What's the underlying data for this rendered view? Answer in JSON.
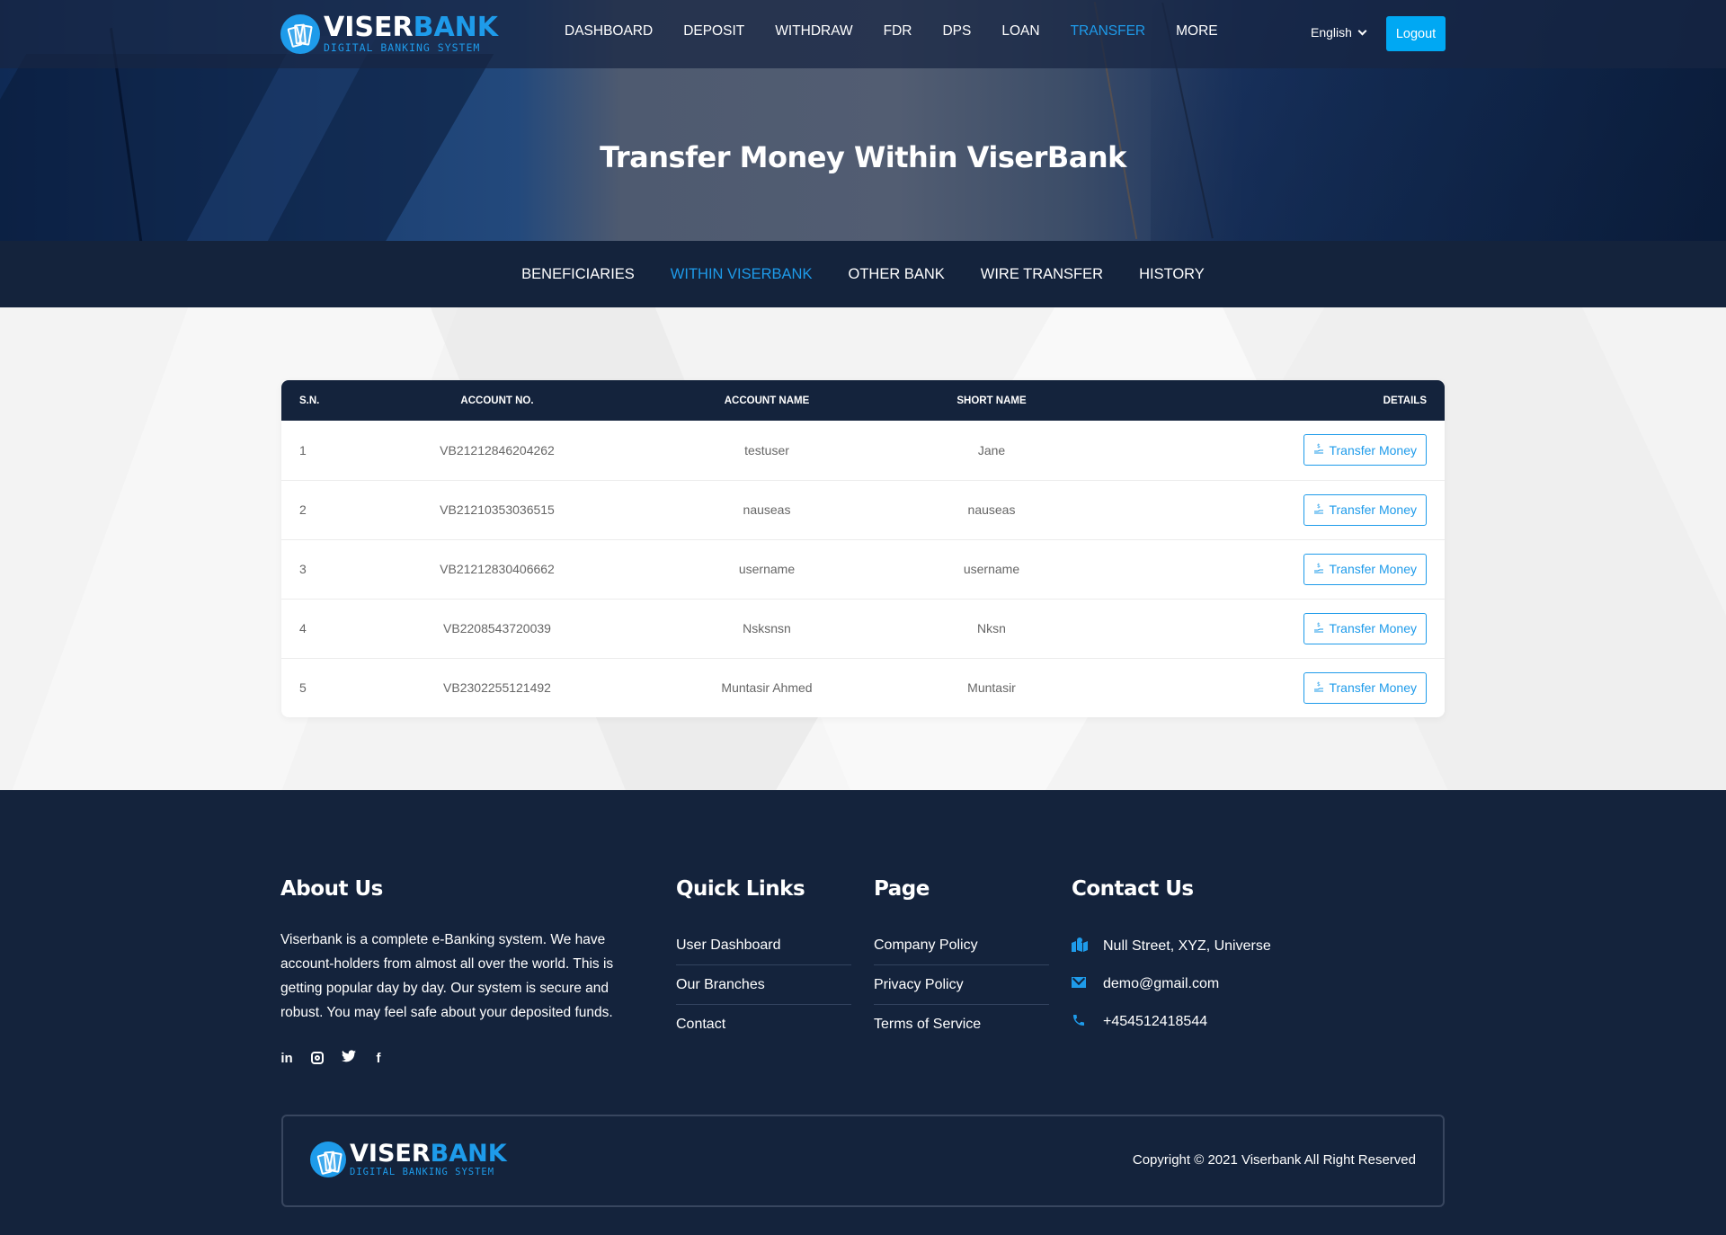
{
  "brand": {
    "name_white": "VISER",
    "name_blue": "BANK",
    "tagline": "DIGITAL BANKING SYSTEM",
    "accent_color": "#1e9bea",
    "dark_color": "#14233c"
  },
  "header": {
    "nav": [
      {
        "label": "DASHBOARD",
        "active": false
      },
      {
        "label": "DEPOSIT",
        "active": false
      },
      {
        "label": "WITHDRAW",
        "active": false
      },
      {
        "label": "FDR",
        "active": false
      },
      {
        "label": "DPS",
        "active": false
      },
      {
        "label": "LOAN",
        "active": false
      },
      {
        "label": "TRANSFER",
        "active": true
      },
      {
        "label": "MORE",
        "active": false
      }
    ],
    "language": "English",
    "logout_label": "Logout"
  },
  "hero": {
    "title": "Transfer Money Within ViserBank"
  },
  "subnav": {
    "tabs": [
      {
        "label": "BENEFICIARIES",
        "active": false
      },
      {
        "label": "WITHIN VISERBANK",
        "active": true
      },
      {
        "label": "OTHER BANK",
        "active": false
      },
      {
        "label": "WIRE TRANSFER",
        "active": false
      },
      {
        "label": "HISTORY",
        "active": false
      }
    ]
  },
  "table": {
    "headers": [
      "S.N.",
      "ACCOUNT NO.",
      "ACCOUNT NAME",
      "SHORT NAME",
      "DETAILS"
    ],
    "action_label": "Transfer Money",
    "action_icon": "hand-holding-dollar-icon",
    "rows": [
      {
        "sn": "1",
        "account_no": "VB21212846204262",
        "account_name": "testuser",
        "short_name": "Jane"
      },
      {
        "sn": "2",
        "account_no": "VB21210353036515",
        "account_name": "nauseas",
        "short_name": "nauseas"
      },
      {
        "sn": "3",
        "account_no": "VB21212830406662",
        "account_name": "username",
        "short_name": "username"
      },
      {
        "sn": "4",
        "account_no": "VB2208543720039",
        "account_name": "Nsksnsn",
        "short_name": "Nksn"
      },
      {
        "sn": "5",
        "account_no": "VB2302255121492",
        "account_name": "Muntasir Ahmed",
        "short_name": "Muntasir"
      }
    ]
  },
  "footer": {
    "about": {
      "title": "About Us",
      "text": "Viserbank is a complete e-Banking system. We have account-holders from almost all over the world. This is getting popular day by day. Our system is secure and robust. You may feel safe about your deposited funds.",
      "social": [
        "linkedin-icon",
        "instagram-icon",
        "twitter-icon",
        "facebook-icon"
      ]
    },
    "quick_links": {
      "title": "Quick Links",
      "items": [
        "User Dashboard",
        "Our Branches",
        "Contact"
      ]
    },
    "page": {
      "title": "Page",
      "items": [
        "Company Policy",
        "Privacy Policy",
        "Terms of Service"
      ]
    },
    "contact": {
      "title": "Contact Us",
      "address": "Null Street, XYZ, Universe",
      "email": "demo@gmail.com",
      "phone": "+454512418544"
    },
    "copyright": "Copyright © 2021 Viserbank All Right Reserved"
  }
}
